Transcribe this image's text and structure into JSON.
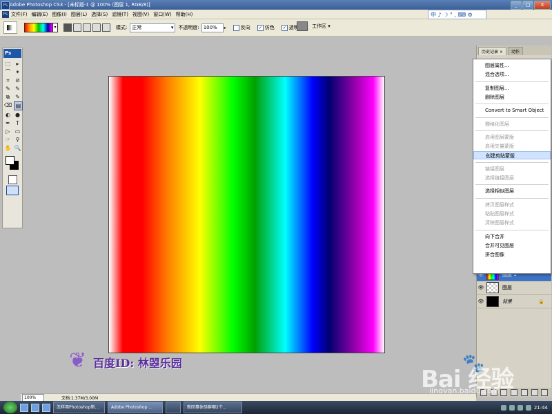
{
  "window": {
    "title": "Adobe Photoshop CS3 - [未标题-1 @ 100% (图层 1, RGB/8)]",
    "app_icon": "Ps",
    "minimize": "_",
    "maximize": "□",
    "close": "X"
  },
  "menubar": {
    "items": [
      "文件(F)",
      "编辑(E)",
      "图像(I)",
      "图层(L)",
      "选择(S)",
      "滤镜(T)",
      "视图(V)",
      "窗口(W)",
      "帮助(H)"
    ]
  },
  "ime": {
    "text": "中 ♪ ☽ ° , ⌨ ⚙"
  },
  "options": {
    "mode_label": "模式:",
    "mode_value": "正常",
    "opacity_label": "不透明度:",
    "opacity_value": "100%",
    "reverse": {
      "label": "反向",
      "checked": false
    },
    "dither": {
      "label": "仿色",
      "checked": true
    },
    "transparency": {
      "label": "透明区域",
      "checked": true
    },
    "workspace": "工作区 ▾"
  },
  "toolbox": {
    "logo": "Ps",
    "tools": [
      "⬚",
      "▸",
      "⌒",
      "✶",
      "⌗",
      "⊘",
      "✎",
      "✎",
      "⧉",
      "✎",
      "⌫",
      "▤",
      "◐",
      "●",
      "✒",
      "T",
      "▷",
      "▭",
      "☞",
      "⚲",
      "✋",
      "🔍"
    ]
  },
  "layers_panel": {
    "tabs": [
      "历史记录 ×",
      "动作"
    ],
    "layers": [
      {
        "name": "图层 1",
        "thumb": "gradient"
      },
      {
        "name": "图层",
        "thumb": "transparent"
      },
      {
        "name": "背景",
        "thumb": "black",
        "lock": "🔒"
      }
    ]
  },
  "context_menu": {
    "items": [
      {
        "label": "图层属性...",
        "enabled": true
      },
      {
        "label": "混合选项...",
        "enabled": true
      },
      {
        "sep": true
      },
      {
        "label": "复制图层...",
        "enabled": true
      },
      {
        "label": "删除图层",
        "enabled": true
      },
      {
        "sep": true
      },
      {
        "label": "Convert to Smart Object",
        "enabled": true
      },
      {
        "sep": true
      },
      {
        "label": "栅格化图层",
        "enabled": false
      },
      {
        "sep": true
      },
      {
        "label": "启用图层蒙版",
        "enabled": false
      },
      {
        "label": "启用矢量蒙版",
        "enabled": false
      },
      {
        "label": "创建剪贴蒙版",
        "enabled": true,
        "highlighted": true
      },
      {
        "sep": true
      },
      {
        "label": "链接图层",
        "enabled": false
      },
      {
        "label": "选择链接图层",
        "enabled": false
      },
      {
        "sep": true
      },
      {
        "label": "选择相似图层",
        "enabled": true
      },
      {
        "sep": true
      },
      {
        "label": "拷贝图层样式",
        "enabled": false
      },
      {
        "label": "粘贴图层样式",
        "enabled": false
      },
      {
        "label": "清除图层样式",
        "enabled": false
      },
      {
        "sep": true
      },
      {
        "label": "向下合并",
        "enabled": true
      },
      {
        "label": "合并可见图层",
        "enabled": true
      },
      {
        "label": "拼合图像",
        "enabled": true
      }
    ]
  },
  "watermark": {
    "text": "百度ID: 林曌乐园",
    "butterfly": "❦"
  },
  "baidu": {
    "logo": "Bai  经验",
    "paw": "🐾",
    "sub": "jingyan.baidu.com"
  },
  "status": {
    "zoom": "100%",
    "doc": "文档:1.37M/3.00M"
  },
  "taskbar": {
    "tasks": [
      "怎样用Photoshop制...",
      "Adobe Photoshop ...",
      "",
      "新回事体验群哪2个..."
    ],
    "clock": "21:44"
  },
  "colors": {
    "canvas_gradient": [
      "#ffffff",
      "#ff0000",
      "#ff7a00",
      "#ffff00",
      "#00ff00",
      "#00a000",
      "#00ffff",
      "#0000ff",
      "#000070",
      "#a000b0",
      "#ff00ff",
      "#ffffff"
    ],
    "menu_highlight": "#cfe3ff",
    "titlebar": "#3b5f97"
  }
}
